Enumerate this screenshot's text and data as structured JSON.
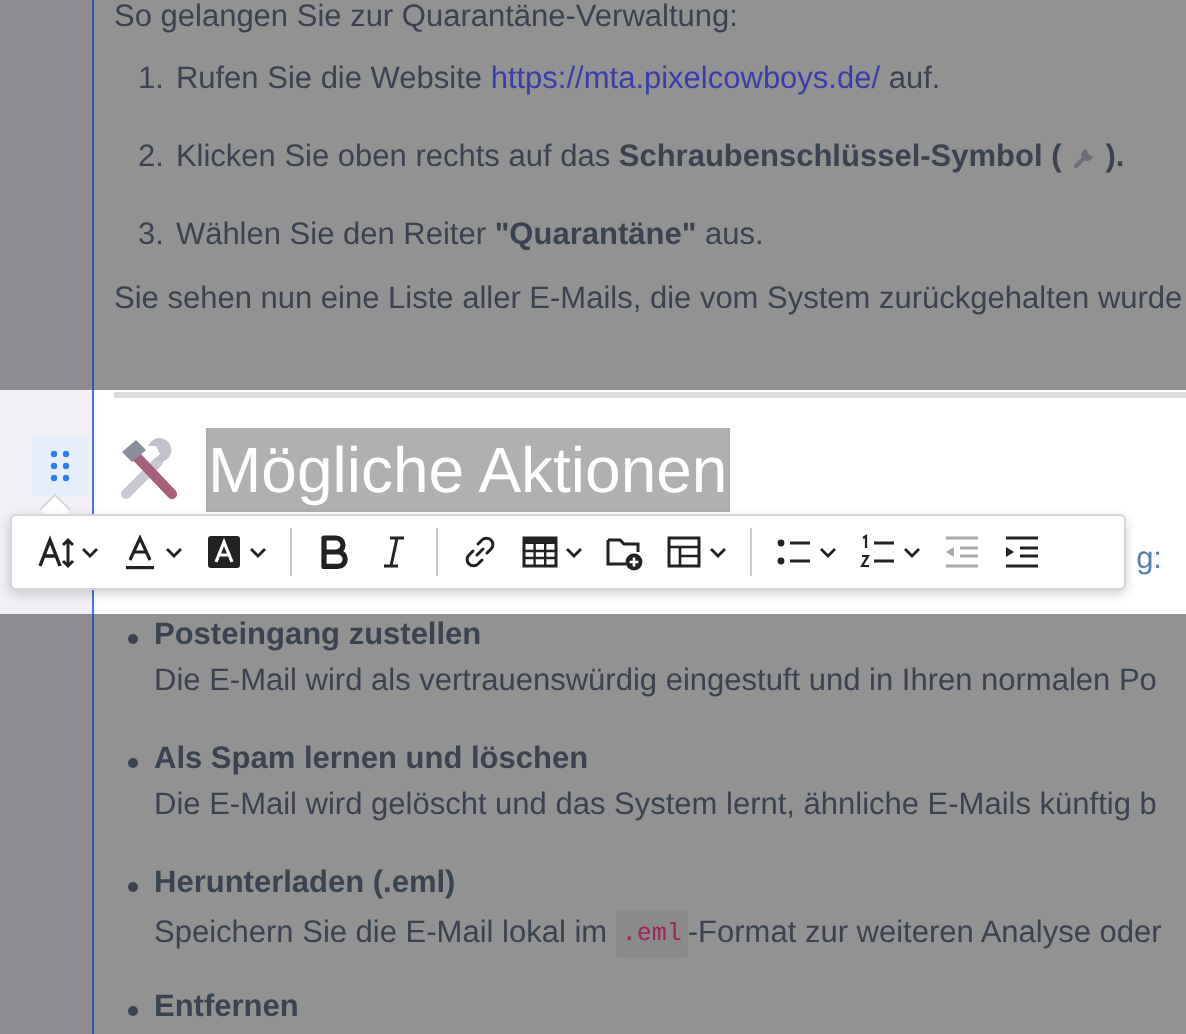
{
  "intro_line": "So gelangen Sie zur Quarantäne-Verwaltung:",
  "steps": [
    {
      "number": "1.",
      "parts": [
        {
          "kind": "text",
          "text": "Rufen Sie die Website "
        },
        {
          "kind": "link",
          "text": "https://mta.pixelcowboys.de/"
        },
        {
          "kind": "text",
          "text": " auf."
        }
      ]
    },
    {
      "number": "2.",
      "parts": [
        {
          "kind": "text",
          "text": "Klicken Sie oben rechts auf das **Schraubenschlüssel-Symbol (**"
        },
        {
          "kind": "icon"
        },
        {
          "kind": "text",
          "text": "**).**"
        }
      ]
    },
    {
      "number": "3.",
      "parts": [
        {
          "kind": "text",
          "text": "Wählen Sie den Reiter **\"Quarantäne\"** aus."
        }
      ]
    }
  ],
  "summary": "Sie sehen nun eine Liste aller E-Mails, die vom System zurückgehalten wurde",
  "heading": {
    "text": "Mögliche Aktionen",
    "selected": true
  },
  "hidden_line_tail": "g:",
  "toolbar": [
    {
      "kind": "font-size",
      "dropdown": true,
      "disabled": false
    },
    {
      "kind": "text-color",
      "dropdown": true,
      "disabled": false
    },
    {
      "kind": "highlight",
      "dropdown": true,
      "disabled": false
    },
    {
      "kind": "separator"
    },
    {
      "kind": "bold",
      "dropdown": false,
      "disabled": false
    },
    {
      "kind": "italic",
      "dropdown": false,
      "disabled": false
    },
    {
      "kind": "separator"
    },
    {
      "kind": "link",
      "dropdown": false,
      "disabled": false
    },
    {
      "kind": "table",
      "dropdown": true,
      "disabled": false
    },
    {
      "kind": "folder-add",
      "dropdown": false,
      "disabled": false
    },
    {
      "kind": "layout",
      "dropdown": true,
      "disabled": false
    },
    {
      "kind": "separator"
    },
    {
      "kind": "bullet-list",
      "dropdown": true,
      "disabled": false
    },
    {
      "kind": "numbered-list",
      "dropdown": true,
      "disabled": false
    },
    {
      "kind": "outdent",
      "dropdown": false,
      "disabled": true
    },
    {
      "kind": "indent",
      "dropdown": false,
      "disabled": false
    }
  ],
  "actions": [
    {
      "title": "Posteingang zustellen",
      "parts": [
        {
          "kind": "text",
          "text": "Die E-Mail wird als vertrauenswürdig eingestuft und in Ihren normalen Po"
        }
      ]
    },
    {
      "title": "Als Spam lernen und löschen",
      "parts": [
        {
          "kind": "text",
          "text": "Die E-Mail wird gelöscht und das System lernt, ähnliche E-Mails künftig b"
        }
      ]
    },
    {
      "title": "Herunterladen (.eml)",
      "parts": [
        {
          "kind": "text",
          "text": "Speichern Sie die E-Mail lokal im "
        },
        {
          "kind": "code",
          "text": ".eml"
        },
        {
          "kind": "text",
          "text": "-Format zur weiteren Analyse oder"
        }
      ]
    },
    {
      "title": "Entfernen"
    }
  ]
}
